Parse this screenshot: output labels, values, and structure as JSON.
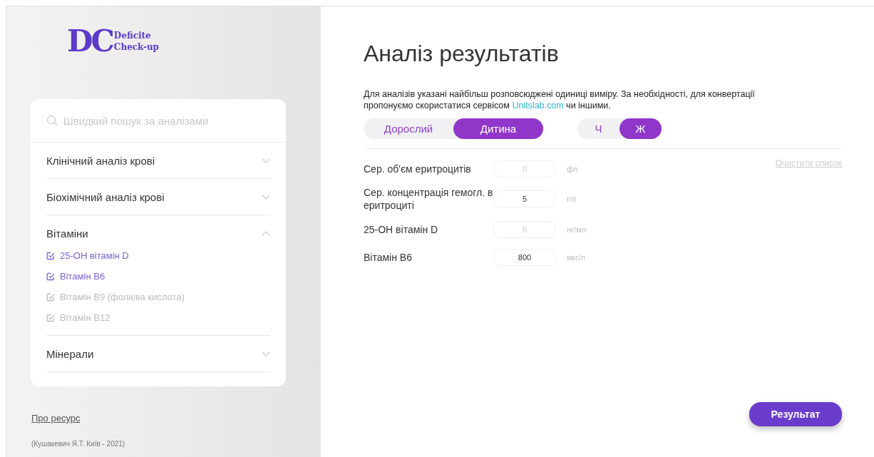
{
  "logo": {
    "mark": "DC",
    "line1": "Deficite",
    "line2": "Check-up"
  },
  "search": {
    "placeholder": "Швидкий пошук за аналізами"
  },
  "categories": [
    {
      "label": "Клінічний аналіз крові",
      "expanded": false
    },
    {
      "label": "Біохімічний аналіз крові",
      "expanded": false
    },
    {
      "label": "Вітаміни",
      "expanded": true,
      "children": [
        {
          "label": "25-ОН вітамін D",
          "checked": true
        },
        {
          "label": "Вітамін В6",
          "checked": true
        },
        {
          "label": "Вітамін В9 (фолієва кислота)",
          "checked": false
        },
        {
          "label": "Вітамін В12",
          "checked": false
        }
      ]
    },
    {
      "label": "Мінерали",
      "expanded": false
    }
  ],
  "footer": {
    "link": "Про ресурс",
    "credit": "(Кушакевич Я.Т. Київ - 2021)"
  },
  "title": "Аналіз результатів",
  "note": {
    "before": "Для аналізів указані найбільш розповсюджені одиниці виміру. За необхідності, для конвертації пропонуємо скористатися сервісом",
    "link": "Unitslab.com",
    "after": "чи іншими."
  },
  "age_toggle": [
    {
      "label": "Дорослий",
      "selected": false
    },
    {
      "label": "Дитина",
      "selected": true
    }
  ],
  "sex_toggle": [
    {
      "label": "Ч",
      "selected": false
    },
    {
      "label": "Ж",
      "selected": true
    }
  ],
  "clear_link": "Очистити список",
  "fields": [
    {
      "label": "Сер. об'єм еритроцитів",
      "placeholder": "0",
      "unit": "фл"
    },
    {
      "label": "Сер. концентрація гемогл. в еритроциті",
      "value": "5",
      "unit": "г/л"
    },
    {
      "label": "25-ОН вітамін D",
      "placeholder": "0",
      "unit": "нг/мл"
    },
    {
      "label": "Вітамін В6",
      "value": "800",
      "unit": "мкг/л"
    }
  ],
  "result_button": "Результат"
}
